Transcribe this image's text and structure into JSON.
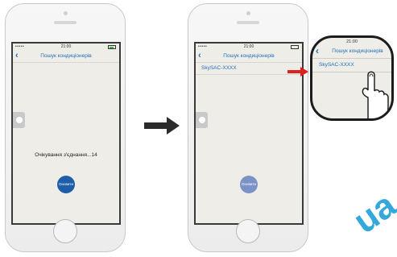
{
  "left_phone": {
    "status": {
      "signal": "•••••",
      "time": "21:00"
    },
    "nav": {
      "back": "‹",
      "title": "Пошук кондиціонерів"
    },
    "status_message": "Очікування з'єднання...14",
    "refresh_label": "Оновити"
  },
  "right_phone": {
    "status": {
      "signal": "•••••",
      "time": "21:00"
    },
    "nav": {
      "back": "‹",
      "title": "Пошук кондиціонерів"
    },
    "device_item": "SkySAC-XXXX",
    "refresh_label": "Оновити"
  },
  "zoom_callout": {
    "time": "21:00",
    "nav": {
      "back": "‹",
      "title": "Пошук кондиціонерів"
    },
    "device_item": "SkySAC-XXXX"
  },
  "watermark": {
    "text": "ua"
  },
  "colors": {
    "accent": "#1f6fb8",
    "button_active": "#1e5ea8",
    "button_faded": "#7b92c6",
    "screen_bg": "#efede7",
    "arrow_dark": "#2b2b2b",
    "arrow_red": "#e02020",
    "watermark": "#1f9fd8"
  },
  "icons": {
    "back": "chevron-left-icon",
    "flow_arrow": "arrow-right-icon",
    "pointer": "pointer-arrow-icon",
    "tap": "finger-tap-icon"
  }
}
